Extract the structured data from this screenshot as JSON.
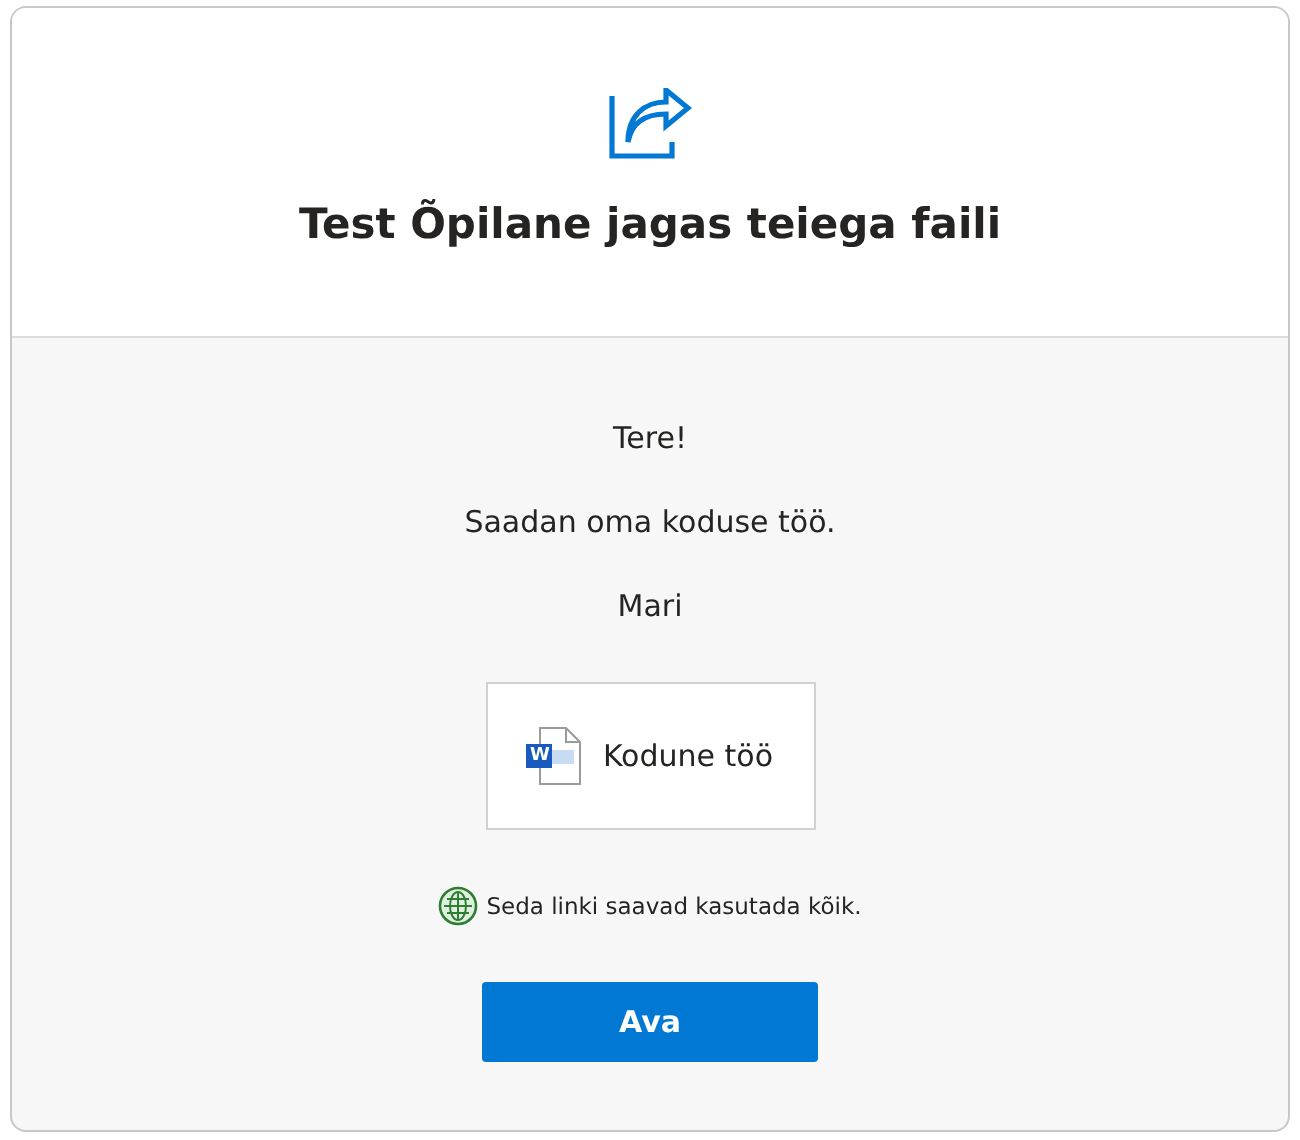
{
  "header": {
    "title": "Test Õpilane jagas teiega faili"
  },
  "message": [
    "Tere!",
    "Saadan oma koduse töö.",
    "Mari"
  ],
  "file": {
    "icon_letter": "W",
    "name": "Kodune töö"
  },
  "access_note": "Seda linki saavad kasutada kõik.",
  "buttons": [
    "Ava"
  ]
}
